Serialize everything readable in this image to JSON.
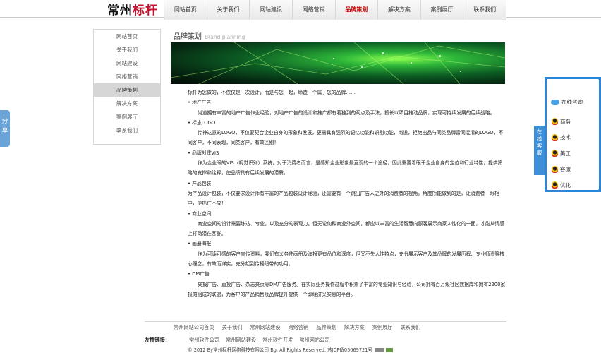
{
  "logo": {
    "text_a": "常州",
    "text_b": "标杆"
  },
  "nav": [
    {
      "label": "网站首页",
      "active": false
    },
    {
      "label": "关于我们",
      "active": false
    },
    {
      "label": "网站建设",
      "active": false
    },
    {
      "label": "网络营销",
      "active": false
    },
    {
      "label": "品牌策划",
      "active": true
    },
    {
      "label": "解决方案",
      "active": false
    },
    {
      "label": "案例展厅",
      "active": false
    },
    {
      "label": "联系我们",
      "active": false
    }
  ],
  "sidebar": [
    "网站首页",
    "关于我们",
    "网站建设",
    "网络营销",
    "品牌策划",
    "解决方案",
    "案例展厅",
    "联系我们"
  ],
  "page": {
    "title": "品牌策划",
    "title_en": "Brand planning"
  },
  "article": [
    {
      "text": "标杆为您做的，不仅仅是一次设计，而是与您一起，缔造一个属于您的品牌……",
      "style": "plain"
    },
    {
      "text": "• 地产广告",
      "style": "plain"
    },
    {
      "text": "尚道拥有丰富的地产广告作业经验，对地产广告的设计和推广都有着独到的观点及手法，擅长以项目推动品牌，实现可持续发展的后续战略。",
      "style": "ind"
    },
    {
      "text": "• 标志LOGO",
      "style": "plain"
    },
    {
      "text": "传神达意的LOGO，不仅要契合企业自身的形象和发展，更需具有强烈的记忆功能和识别功能，尚道，拒绝出品与同类品牌雷同混淆的LOGO，不同客户，不同表现，同类客户，有效区别！",
      "style": "ind"
    },
    {
      "text": "• 品牌创建VIS",
      "style": "plain"
    },
    {
      "text": "作为企业眼的VIS（视觉识别）系统，对于消费者而言，是感知企业形象最直观的一个途径，因此需要着眼于企业自身的定位和行业特性，提供策略的支撑和诠释，使品牌具有后续发展的潜质。",
      "style": "ind"
    },
    {
      "text": "• 产品包装",
      "style": "plain"
    },
    {
      "text": "为产品设计包装，不仅要求设计师有丰富的产品包装设计经验，还需要有一个跳出广告人之外的消费者的视角，角度所能做到的是，让消费者一眼相中，便抓住不放！",
      "style": "blk"
    },
    {
      "text": "• 商业空间",
      "style": "plain"
    },
    {
      "text": "商业空间的设计需要练达、专业，以及充分的表现力。但无论何种商业外空间，都应以丰富的生活智慧向顾客展示商家人性化的一面，才能从情感上打动潜在客群。",
      "style": "ind"
    },
    {
      "text": "• 画册海报",
      "style": "plain"
    },
    {
      "text": "作为可读可感的客户宣传资料，我们有义务使画册及海报更有品位和深度，但又不失人性特点，充分展示客户及其品牌的发展历程、专业师资等核心理念，有效而详实，充分起到传播纽带的功用。",
      "style": "ind"
    },
    {
      "text": "• DM广告",
      "style": "plain"
    },
    {
      "text": "夹报广告、直投广告、杂志夹页等DM广告服务。在实际业务操作过程中积累了丰富的专业知识与经验，公司拥有百万级社区数据库和拥有2200家报摊组成的联盟，为客户的产品销售及品牌提升提供一个即经济又实惠的平台。",
      "style": "ind"
    }
  ],
  "footer": {
    "nav": [
      "常州网站公司首页",
      "关于我们",
      "常州网站建设",
      "网络营销",
      "品牌策划",
      "解决方案",
      "案例展厅",
      "联系我们"
    ],
    "friend_label": "友情链接：",
    "friend_links": [
      "常州软件公司",
      "常州网站建设",
      "常州软件开发",
      "常州网站公司"
    ],
    "copyright": "© 2012 By常州标杆网络科技有限公司 Bg. All Rights Reserved. 苏ICP备05069721号"
  },
  "share": {
    "label": "分享"
  },
  "online": {
    "tab_label": "在线客服",
    "head": "在线咨询",
    "agents": [
      "商务",
      "技术",
      "美工",
      "客服",
      "优化"
    ]
  },
  "colors": {
    "accent_red": "#c8102e",
    "nav_active": "#cc0000",
    "service_blue": "#2d86d6"
  }
}
